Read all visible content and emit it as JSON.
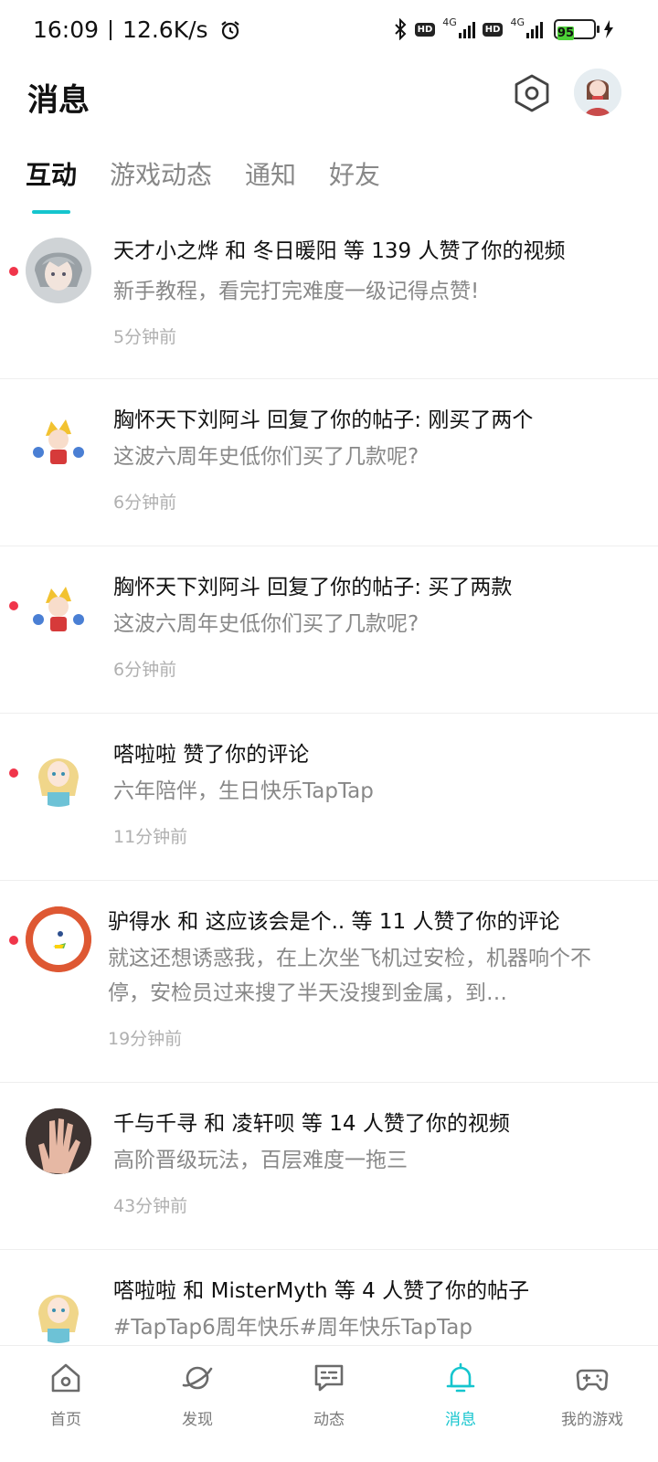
{
  "status_bar": {
    "time": "16:09",
    "speed": "12.6K/s",
    "net1": "4G",
    "net2": "4G",
    "battery": "95",
    "icons": [
      "alarm-icon",
      "bluetooth-icon",
      "hd-icon",
      "signal-icon",
      "battery-icon",
      "charging-icon"
    ]
  },
  "header": {
    "title": "消息",
    "settings_icon": "settings-hexagon-icon",
    "avatar": "profile-avatar"
  },
  "tabs": [
    {
      "label": "互动",
      "active": true
    },
    {
      "label": "游戏动态",
      "active": false
    },
    {
      "label": "通知",
      "active": false
    },
    {
      "label": "好友",
      "active": false
    }
  ],
  "messages": [
    {
      "title": "天才小之烨 和 冬日暖阳 等 139 人赞了你的视频",
      "subtitle": "新手教程，看完打完难度一级记得点赞!",
      "time": "5分钟前",
      "unread": true,
      "avatar": "gray-hair-anime-avatar"
    },
    {
      "title": "胸怀天下刘阿斗 回复了你的帖子: 刚买了两个",
      "subtitle": "这波六周年史低你们买了几款呢?",
      "time": "6分钟前",
      "unread": false,
      "avatar": "yellow-hair-chibi-avatar"
    },
    {
      "title": "胸怀天下刘阿斗 回复了你的帖子: 买了两款",
      "subtitle": "这波六周年史低你们买了几款呢?",
      "time": "6分钟前",
      "unread": true,
      "avatar": "yellow-hair-chibi-avatar"
    },
    {
      "title": "嗒啦啦 赞了你的评论",
      "subtitle": "六年陪伴，生日快乐TapTap",
      "time": "11分钟前",
      "unread": true,
      "avatar": "blonde-anime-girl-avatar"
    },
    {
      "title": "驴得水 和 这应该会是个.. 等 11 人赞了你的评论",
      "subtitle": "就这还想诱惑我，在上次坐飞机过安检，机器响个不停，安检员过来搜了半天没搜到金属，到…",
      "time": "19分钟前",
      "unread": true,
      "avatar": "duck-logo-avatar"
    },
    {
      "title": "千与千寻 和 凌轩呗 等 14 人赞了你的视频",
      "subtitle": "高阶晋级玩法，百层难度一拖三",
      "time": "43分钟前",
      "unread": false,
      "avatar": "hand-photo-avatar"
    },
    {
      "title": "嗒啦啦 和 MisterMyth 等 4 人赞了你的帖子",
      "subtitle": "#TapTap6周年快乐#周年快乐TapTap",
      "time": "",
      "unread": false,
      "avatar": "blonde-anime-girl-avatar"
    }
  ],
  "bottom_nav": [
    {
      "label": "首页",
      "icon": "home-icon",
      "active": false
    },
    {
      "label": "发现",
      "icon": "planet-icon",
      "active": false
    },
    {
      "label": "动态",
      "icon": "chat-icon",
      "active": false
    },
    {
      "label": "消息",
      "icon": "bell-icon",
      "active": true
    },
    {
      "label": "我的游戏",
      "icon": "gamepad-icon",
      "active": false
    }
  ],
  "colors": {
    "accent": "#15c5ce",
    "unread": "#f0354a",
    "battery": "#4cd137"
  }
}
